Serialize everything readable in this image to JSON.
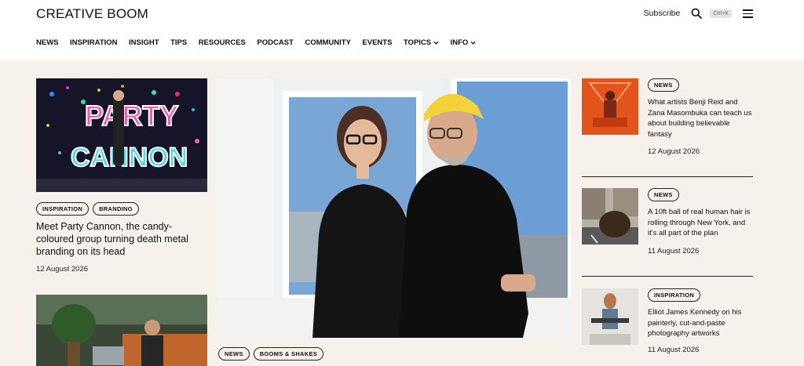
{
  "header": {
    "logo": "CREATIVE BOOM",
    "subscribe_label": "Subscribe",
    "search_shortcut": "Ctrl+K"
  },
  "nav": {
    "items": [
      "NEWS",
      "INSPIRATION",
      "INSIGHT",
      "TIPS",
      "RESOURCES",
      "PODCAST",
      "COMMUNITY",
      "EVENTS",
      "TOPICS",
      "INFO"
    ]
  },
  "left": {
    "tags": [
      "INSPIRATION",
      "BRANDING"
    ],
    "title": "Meet Party Cannon, the candy-coloured group turning death metal branding on its head",
    "date": "12 August 2026"
  },
  "center": {
    "tags": [
      "NEWS",
      "BOOMS & SHAKES"
    ]
  },
  "right": {
    "items": [
      {
        "tag": "NEWS",
        "title": "What artists Benji Reid and Zana Masombuka can teach us about building believable fantasy",
        "date": "12 August 2026"
      },
      {
        "tag": "NEWS",
        "title": "A 10ft ball of real human hair is rolling through New York, and it's all part of the plan",
        "date": "11 August 2026"
      },
      {
        "tag": "INSPIRATION",
        "title": "Elliot James Kennedy on his painterly, cut-and-paste photography artworks",
        "date": "11 August 2026"
      }
    ]
  },
  "colors": {
    "page_bg": "#f6f1ea",
    "header_bg": "#ffffff",
    "text": "#111111"
  }
}
